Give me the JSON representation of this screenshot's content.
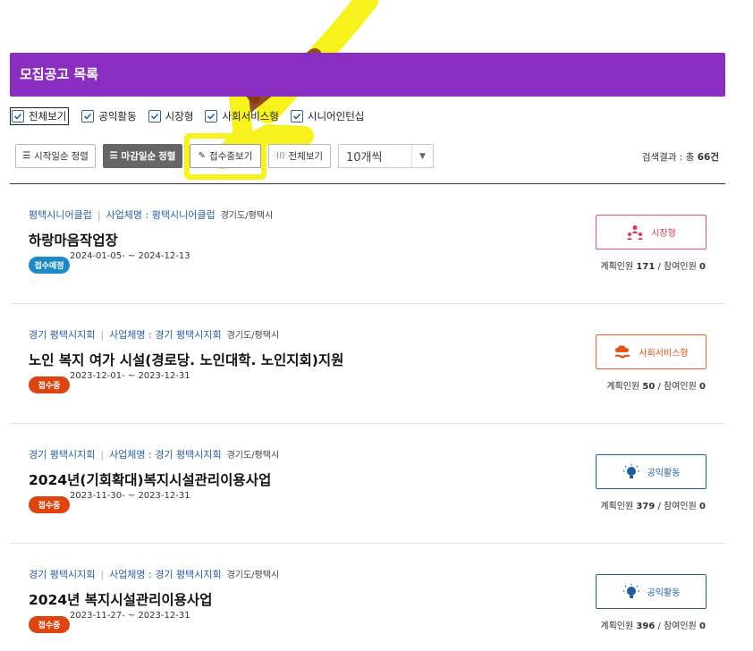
{
  "header": {
    "title": "모집공고 목록"
  },
  "filters": [
    {
      "label": "전체보기",
      "checked": true
    },
    {
      "label": "공익활동",
      "checked": true
    },
    {
      "label": "시장형",
      "checked": true
    },
    {
      "label": "사회서비스형",
      "checked": true
    },
    {
      "label": "시니어인턴십",
      "checked": true
    }
  ],
  "toolbar": {
    "sort_start": "시작일순 정렬",
    "sort_deadline": "마감일순 정렬",
    "accepting": "접수중보기",
    "view_all": "전체보기",
    "per_page": "10개씩",
    "result_prefix": "검색결과 : 총 ",
    "result_count": "66건"
  },
  "list_labels": {
    "sep": "|",
    "planned": "계획인원",
    "participating": "참여인원",
    "slash": "/"
  },
  "items": [
    {
      "org": "평택시니어클럽",
      "biz": "사업체명 : 평택시니어클럽",
      "region": "경기도/평택시",
      "title": "하랑마음작업장",
      "status": "접수예정",
      "dates": "2024-01-05- ~ 2024-12-13",
      "type": "시장형",
      "planned": "171",
      "participating": "0"
    },
    {
      "org": "경기 평택시지회",
      "biz": "사업체명 : 경기 평택시지회",
      "region": "경기도/평택시",
      "title": "노인 복지 여가 시설(경로당. 노인대학. 노인지회)지원",
      "status": "접수중",
      "dates": "2023-12-01- ~ 2023-12-31",
      "type": "사회서비스형",
      "planned": "50",
      "participating": "0"
    },
    {
      "org": "경기 평택시지회",
      "biz": "사업체명 : 경기 평택시지회",
      "region": "경기도/평택시",
      "title": "2024년(기회확대)복지시설관리이용사업",
      "status": "접수중",
      "dates": "2023-11-30- ~ 2023-12-31",
      "type": "공익활동",
      "planned": "379",
      "participating": "0"
    },
    {
      "org": "경기 평택시지회",
      "biz": "사업체명 : 경기 평택시지회",
      "region": "경기도/평택시",
      "title": "2024년 복지시설관리이용사업",
      "status": "접수중",
      "dates": "2023-11-27- ~ 2023-12-31",
      "type": "공익활동",
      "planned": "396",
      "participating": "0"
    }
  ],
  "colors": {
    "header_bg": "#8a2ec2",
    "highlight": "#f7f21c",
    "arrow": "#8a3a10",
    "link_blue": "#2b5fa8",
    "badge_blue": "#1b8acb",
    "badge_red": "#e0440e"
  }
}
